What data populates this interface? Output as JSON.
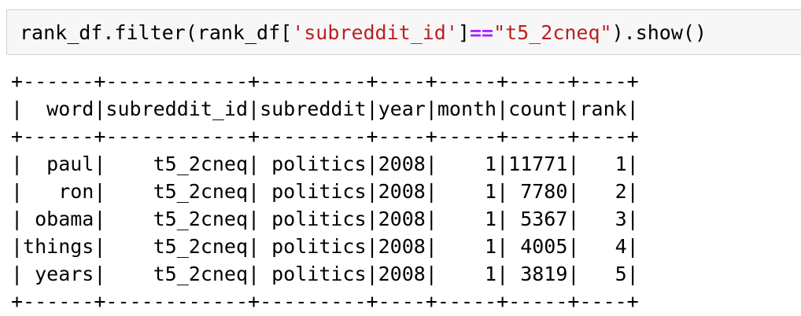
{
  "code": {
    "prefix": "rank_df.filter(rank_df[",
    "key": "'subreddit_id'",
    "op": "==",
    "value": "\"t5_2cneq\"",
    "suffix": ").show()"
  },
  "table": {
    "border": "+------+------------+---------+----+-----+-----+----+",
    "header": "|  word|subreddit_id|subreddit|year|month|count|rank|",
    "rows": [
      "|  paul|    t5_2cneq| politics|2008|    1|11771|   1|",
      "|   ron|    t5_2cneq| politics|2008|    1| 7780|   2|",
      "| obama|    t5_2cneq| politics|2008|    1| 5367|   3|",
      "|things|    t5_2cneq| politics|2008|    1| 4005|   4|",
      "| years|    t5_2cneq| politics|2008|    1| 3819|   5|"
    ]
  },
  "colors": {
    "string": "#ba2121",
    "operator": "#aa22ff",
    "cell_bg": "#f7f7f7"
  }
}
